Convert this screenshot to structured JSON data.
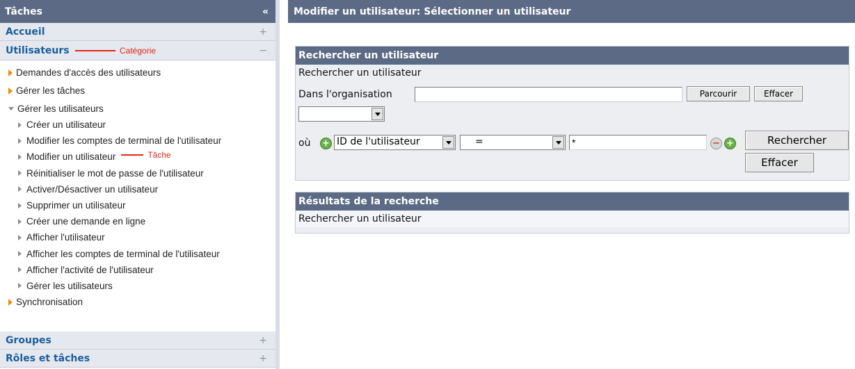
{
  "sidebar": {
    "title": "Tâches",
    "collapse_glyph": "«",
    "categories": {
      "accueil": {
        "label": "Accueil",
        "toggle": "+"
      },
      "utilisateurs": {
        "label": "Utilisateurs",
        "toggle": "−"
      },
      "groupes": {
        "label": "Groupes",
        "toggle": "+"
      },
      "roles": {
        "label": "Rôles et tâches",
        "toggle": "+"
      }
    },
    "annotations": {
      "category": "Catégorie",
      "task": "Tâche"
    },
    "tasks": [
      "Demandes d'accès des utilisateurs",
      "Gérer les tâches",
      "Gérer les utilisateurs",
      "Synchronisation"
    ],
    "subtasks": [
      "Créer un utilisateur",
      "Modifier les comptes de terminal de l'utilisateur",
      "Modifier un utilisateur",
      "Réinitialiser le mot de passe de l'utilisateur",
      "Activer/Désactiver un utilisateur",
      "Supprimer un utilisateur",
      "Créer une demande en ligne",
      "Afficher l'utilisateur",
      "Afficher les comptes de terminal de l'utilisateur",
      "Afficher l'activité de l'utilisateur",
      "Gérer les utilisateurs"
    ]
  },
  "main": {
    "title": "Modifier un utilisateur: Sélectionner un utilisateur",
    "search_panel": {
      "title": "Rechercher un utilisateur",
      "subtitle": "Rechercher un utilisateur",
      "org_label": "Dans l'organisation",
      "org_value": "",
      "browse_button": "Parcourir",
      "clear_small_button": "Effacer",
      "where_label": "où",
      "attribute_select": "ID de l'utilisateur",
      "operator_select": "=",
      "value_field": "*",
      "search_button": "Rechercher",
      "clear_button": "Effacer"
    },
    "results_panel": {
      "title": "Résultats de la recherche",
      "text": "Rechercher un utilisateur"
    }
  },
  "colors": {
    "header": "#5c6a85",
    "category_text": "#1c5f9c",
    "annotation": "#e1261c",
    "arrow": "#f28c00"
  }
}
